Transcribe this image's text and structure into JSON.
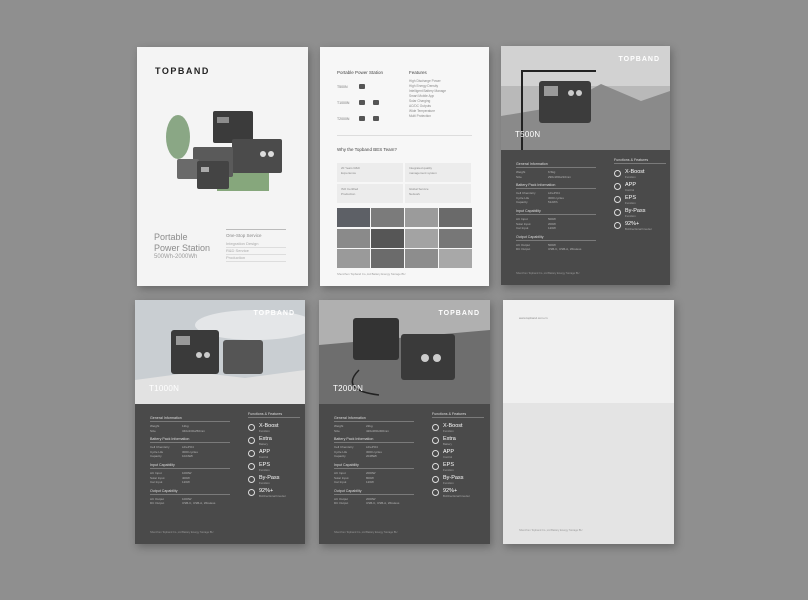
{
  "brand": "TOPBAND",
  "sheet1": {
    "title_line1": "Portable",
    "title_line2": "Power Station",
    "subtitle": "500Wh-2000Wh",
    "side_head": "One-Stop Service",
    "side_lines": [
      "Integration Design",
      "R&D Service",
      "Production"
    ]
  },
  "sheet2": {
    "col1_head": "Portable Power Station",
    "col2_head": "Features",
    "products": [
      "T500N",
      "T1000N",
      "T2000N"
    ],
    "features": [
      "High Discharge Power",
      "High Energy Density",
      "Intelligent Battery Manage",
      "Smart Mobile App",
      "Solar Charging",
      "AC/DC Outputs",
      "Wide Temperature",
      "Multi Protection"
    ],
    "why": "Why the Topband BES Team?",
    "cells": [
      [
        "20 Years R&D",
        "Experience"
      ],
      [
        "Integrated quality",
        "management system"
      ],
      [
        "ISO Certified",
        "Production"
      ],
      [
        "Global Service",
        "Network"
      ]
    ],
    "footer": "Shenzhen Topband Co.,Ltd Battery Energy Storage BU"
  },
  "spec_labels": {
    "general": "General Information",
    "battery": "Battery Pack Information",
    "input": "Input Capability",
    "output": "Output Capability",
    "features": "Functions & Features",
    "weight": "Weight",
    "size": "Size",
    "cell": "Cell Chemistry",
    "cycle": "Cycle Life",
    "capacity": "Capacity",
    "ac_in": "AC Input",
    "solar_in": "Solar Input",
    "car_in": "Car Input",
    "ac_out": "AC Output",
    "dc_out": "DC Output"
  },
  "feature_items": [
    {
      "t1": "X-Boost",
      "t2": "Function"
    },
    {
      "t1": "Extra",
      "t2": "Battery"
    },
    {
      "t1": "APP",
      "t2": "Control"
    },
    {
      "t1": "EPS",
      "t2": "Function"
    },
    {
      "t1": "By-Pass",
      "t2": "Function"
    },
    {
      "t1": "92%+",
      "t2": "Bi-Directional Inverter"
    }
  ],
  "models": {
    "t500": {
      "name": "T500N",
      "weight": "6.5kg",
      "size": "290x180x210mm",
      "cell": "LiFePO4",
      "cycle": "3000 cycles",
      "capacity": "512Wh",
      "ac_in": "500W",
      "solar_in": "200W",
      "car_in": "120W",
      "ac_out": "500W",
      "dc_out": "USB-C, USB-A, Wireless"
    },
    "t1000": {
      "name": "T1000N",
      "weight": "12kg",
      "size": "340x230x250mm",
      "cell": "LiFePO4",
      "cycle": "3000 cycles",
      "capacity": "1024Wh",
      "ac_in": "1000W",
      "solar_in": "400W",
      "car_in": "120W",
      "ac_out": "1000W",
      "dc_out": "USB-C, USB-A, Wireless"
    },
    "t2000": {
      "name": "T2000N",
      "weight": "22kg",
      "size": "420x280x300mm",
      "cell": "LiFePO4",
      "cycle": "3000 cycles",
      "capacity": "2048Wh",
      "ac_in": "2000W",
      "solar_in": "800W",
      "car_in": "120W",
      "ac_out": "2000W",
      "dc_out": "USB-C, USB-A, Wireless"
    }
  },
  "sheet6": {
    "top_text": "www.topband.com.cn",
    "footer": "Shenzhen Topband Co.,Ltd Battery Energy Storage BU"
  },
  "colors": {
    "background": "#8f8f8f",
    "dark_panel": "#4a4a4a",
    "green_accent": "#7f9a76"
  }
}
